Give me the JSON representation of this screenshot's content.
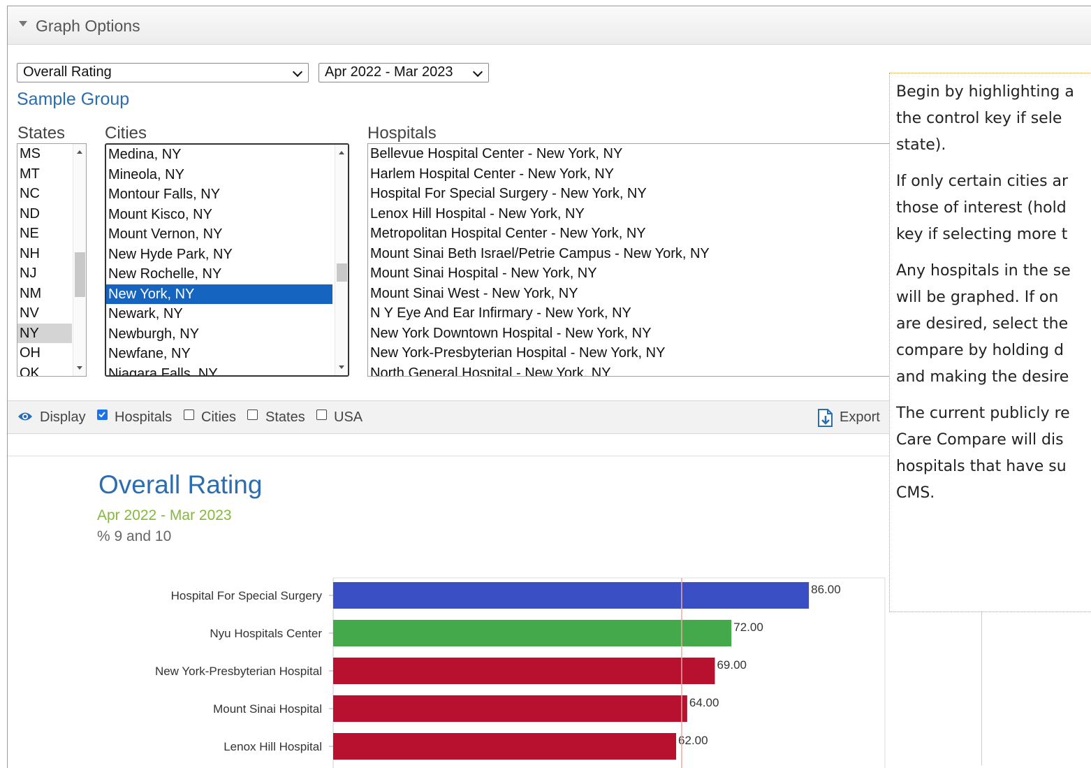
{
  "panel": {
    "title": "Graph Options"
  },
  "measure_select": {
    "value": "Overall Rating"
  },
  "period_select": {
    "value": "Apr 2022 - Mar 2023"
  },
  "sample_group": "Sample Group",
  "states": {
    "label": "States",
    "items": [
      "MS",
      "MT",
      "NC",
      "ND",
      "NE",
      "NH",
      "NJ",
      "NM",
      "NV",
      "NY",
      "OH",
      "OK"
    ],
    "selected": "NY"
  },
  "cities": {
    "label": "Cities",
    "items": [
      "Medina, NY",
      "Mineola, NY",
      "Montour Falls, NY",
      "Mount Kisco, NY",
      "Mount Vernon, NY",
      "New Hyde Park, NY",
      "New Rochelle, NY",
      "New York, NY",
      "Newark, NY",
      "Newburgh, NY",
      "Newfane, NY",
      "Niagara Falls, NY"
    ],
    "selected": "New York, NY"
  },
  "hospitals": {
    "label": "Hospitals",
    "items": [
      "Bellevue Hospital Center - New York, NY",
      "Harlem Hospital Center - New York, NY",
      "Hospital For Special Surgery - New York, NY",
      "Lenox Hill Hospital - New York, NY",
      "Metropolitan Hospital Center - New York, NY",
      "Mount Sinai Beth Israel/Petrie Campus - New York, NY",
      "Mount Sinai Hospital - New York, NY",
      "Mount Sinai West - New York, NY",
      "N Y Eye And Ear Infirmary - New York, NY",
      "New York Downtown Hospital - New York, NY",
      "New York-Presbyterian Hospital - New York, NY",
      "North General Hospital - New York, NY"
    ]
  },
  "display": {
    "label": "Display",
    "options": [
      {
        "label": "Hospitals",
        "checked": true
      },
      {
        "label": "Cities",
        "checked": false
      },
      {
        "label": "States",
        "checked": false
      },
      {
        "label": "USA",
        "checked": false
      }
    ],
    "export_label": "Export"
  },
  "tooltip": {
    "paragraphs": [
      [
        "Begin by highlighting a",
        "the control key if sele",
        "state)."
      ],
      [
        "If only certain cities ar",
        "those of interest (hold",
        "key if selecting more t"
      ],
      [
        "Any hospitals in the se",
        "will be graphed.  If on",
        "are desired, select the",
        "compare by holding d",
        "and making the desire"
      ],
      [
        "The current publicly re",
        "Care Compare will dis",
        "hospitals that have su",
        "CMS."
      ]
    ]
  },
  "chart_data": {
    "type": "bar",
    "title": "Overall Rating",
    "subtitle": "Apr 2022 - Mar 2023",
    "ylabel": "% 9 and 10",
    "categories": [
      "Hospital For Special Surgery",
      "Nyu Hospitals Center",
      "New York-Presbyterian Hospital",
      "Mount Sinai Hospital",
      "Lenox Hill Hospital"
    ],
    "values": [
      86,
      72,
      69,
      64,
      62
    ],
    "value_labels": [
      "86.00",
      "72.00",
      "69.00",
      "64.00",
      "62.00"
    ],
    "colors": [
      "#3b4fc4",
      "#43a94a",
      "#b8102f",
      "#b8102f",
      "#b8102f"
    ],
    "reference_line": 63,
    "xlim": [
      0,
      100
    ],
    "orientation": "horizontal",
    "grid": false
  }
}
